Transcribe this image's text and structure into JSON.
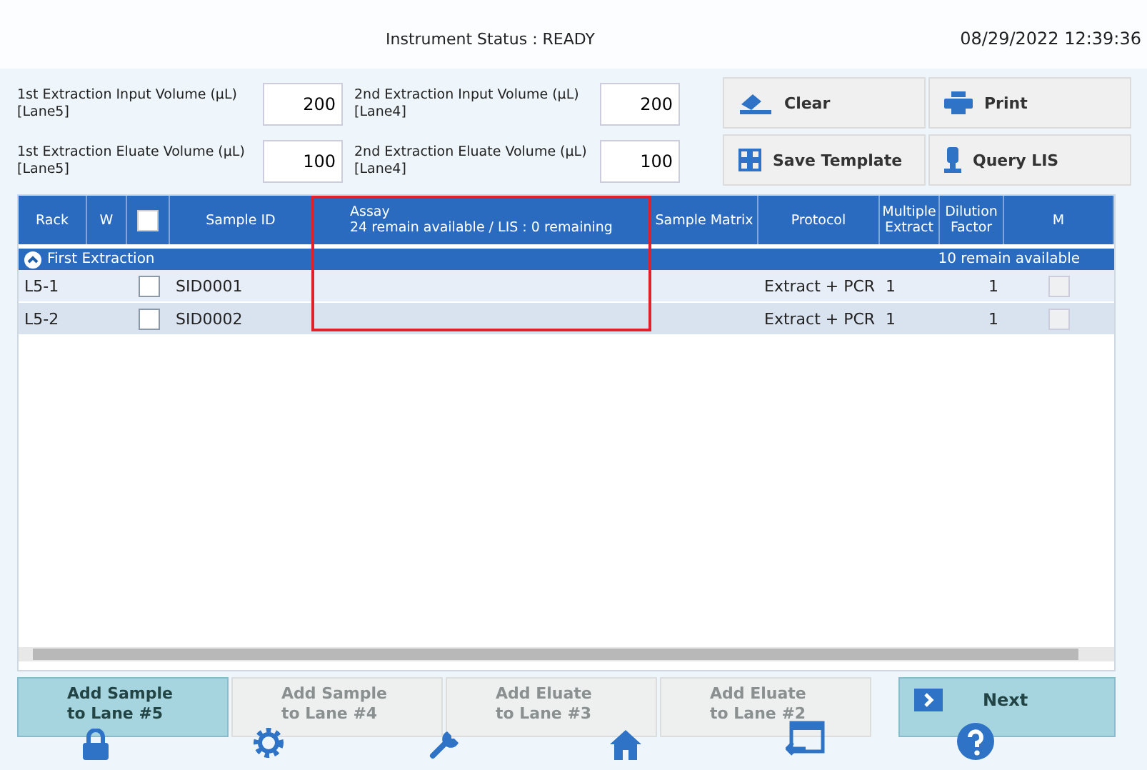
{
  "header": {
    "instrument_status": "Instrument Status : READY",
    "datetime": "08/29/2022 12:39:36"
  },
  "volumes": [
    {
      "label": "1st Extraction Input Volume (µL) [Lane5]",
      "value": "200"
    },
    {
      "label": "2nd Extraction Input Volume (µL) [Lane4]",
      "value": "200"
    },
    {
      "label": "1st Extraction Eluate Volume (µL) [Lane5]",
      "value": "100"
    },
    {
      "label": "2nd Extraction Eluate Volume (µL) [Lane4]",
      "value": "100"
    }
  ],
  "actions": [
    {
      "kind": "clear",
      "label": "Clear"
    },
    {
      "kind": "print",
      "label": "Print"
    },
    {
      "kind": "template",
      "label": "Save Template"
    },
    {
      "kind": "lis",
      "label": "Query LIS"
    }
  ],
  "table": {
    "columns": [
      "Rack",
      "W",
      "",
      "Sample ID",
      "Assay\n24 remain available / LIS : 0 remaining",
      "Sample Matrix",
      "Protocol",
      "Multiple Extract",
      "Dilution Factor",
      "M"
    ],
    "header_checkbox": {
      "checked": false
    },
    "group": {
      "label": "First Extraction",
      "expanded": true,
      "note": "10 remain available"
    },
    "rows": [
      {
        "rack": "L5-1",
        "checked": false,
        "sample_id": "SID0001",
        "protocol": "Extract + PCR",
        "multiple_extract": "1",
        "dilution_factor": "1",
        "m_checked": false
      },
      {
        "rack": "L5-2",
        "checked": false,
        "sample_id": "SID0002",
        "protocol": "Extract + PCR",
        "multiple_extract": "1",
        "dilution_factor": "1",
        "m_checked": false
      }
    ]
  },
  "lane_buttons": [
    {
      "label": "Add Sample to Lane #5",
      "selected": true
    },
    {
      "label": "Add Sample to Lane #4",
      "selected": false
    },
    {
      "label": "Add Eluate to Lane #3",
      "selected": false
    },
    {
      "label": "Add Eluate to Lane #2",
      "selected": false
    }
  ],
  "next_button": {
    "label": "Next"
  }
}
